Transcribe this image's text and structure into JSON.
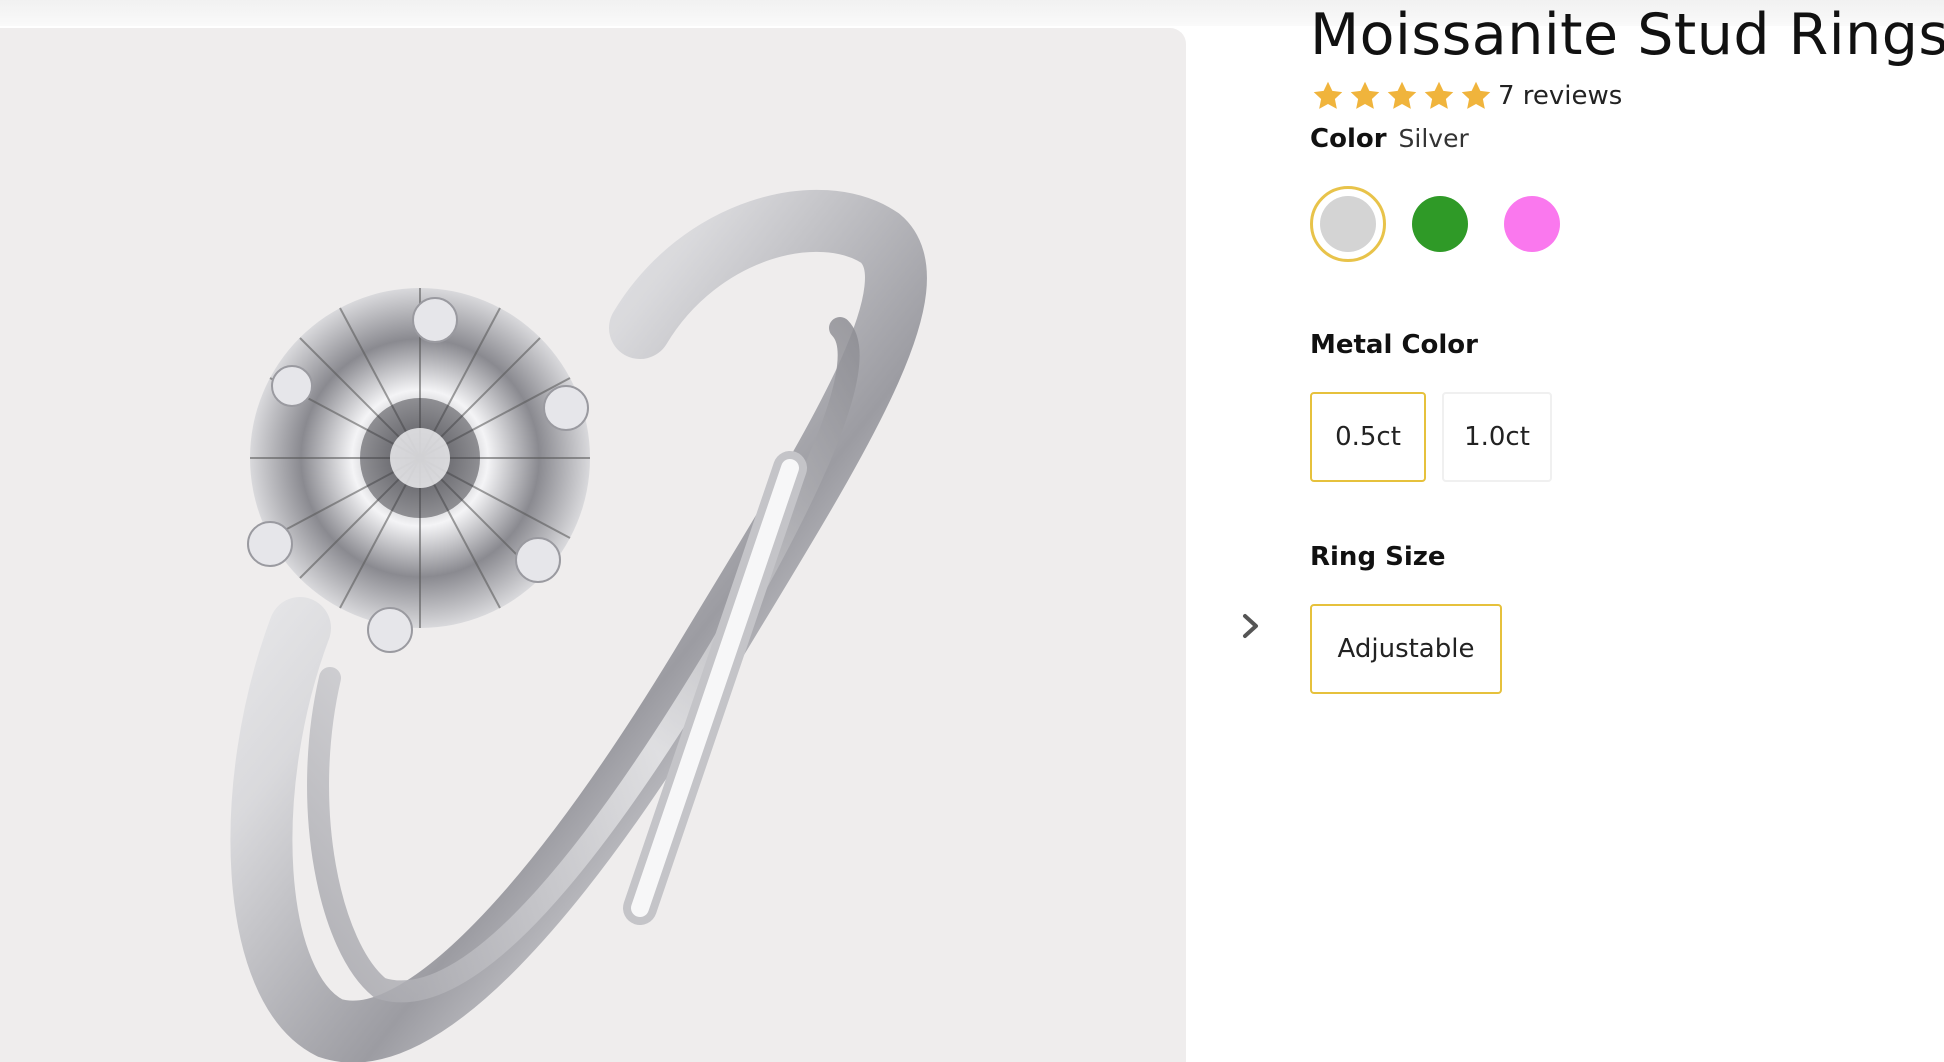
{
  "product": {
    "title": "Moissanite Stud Rings",
    "rating": {
      "stars": 5,
      "reviews_text": "7 reviews",
      "star_color": "#f0b43c"
    }
  },
  "options": {
    "color": {
      "label": "Color",
      "selected_value": "Silver",
      "swatches": [
        {
          "name": "Silver",
          "hex": "#d4d4d4",
          "selected": true
        },
        {
          "name": "Green",
          "hex": "#2f9a27",
          "selected": false
        },
        {
          "name": "Pink",
          "hex": "#fa78ee",
          "selected": false
        }
      ]
    },
    "metal_color": {
      "label": "Metal Color",
      "choices": [
        {
          "label": "0.5ct",
          "selected": true
        },
        {
          "label": "1.0ct",
          "selected": false
        }
      ]
    },
    "ring_size": {
      "label": "Ring Size",
      "choices": [
        {
          "label": "Adjustable",
          "selected": true
        }
      ]
    }
  },
  "gallery": {
    "image_subject": "ring-photo",
    "next_icon": "chevron-right-icon"
  },
  "theme": {
    "accent": "#e6c13c",
    "gallery_bg": "#efeded"
  }
}
